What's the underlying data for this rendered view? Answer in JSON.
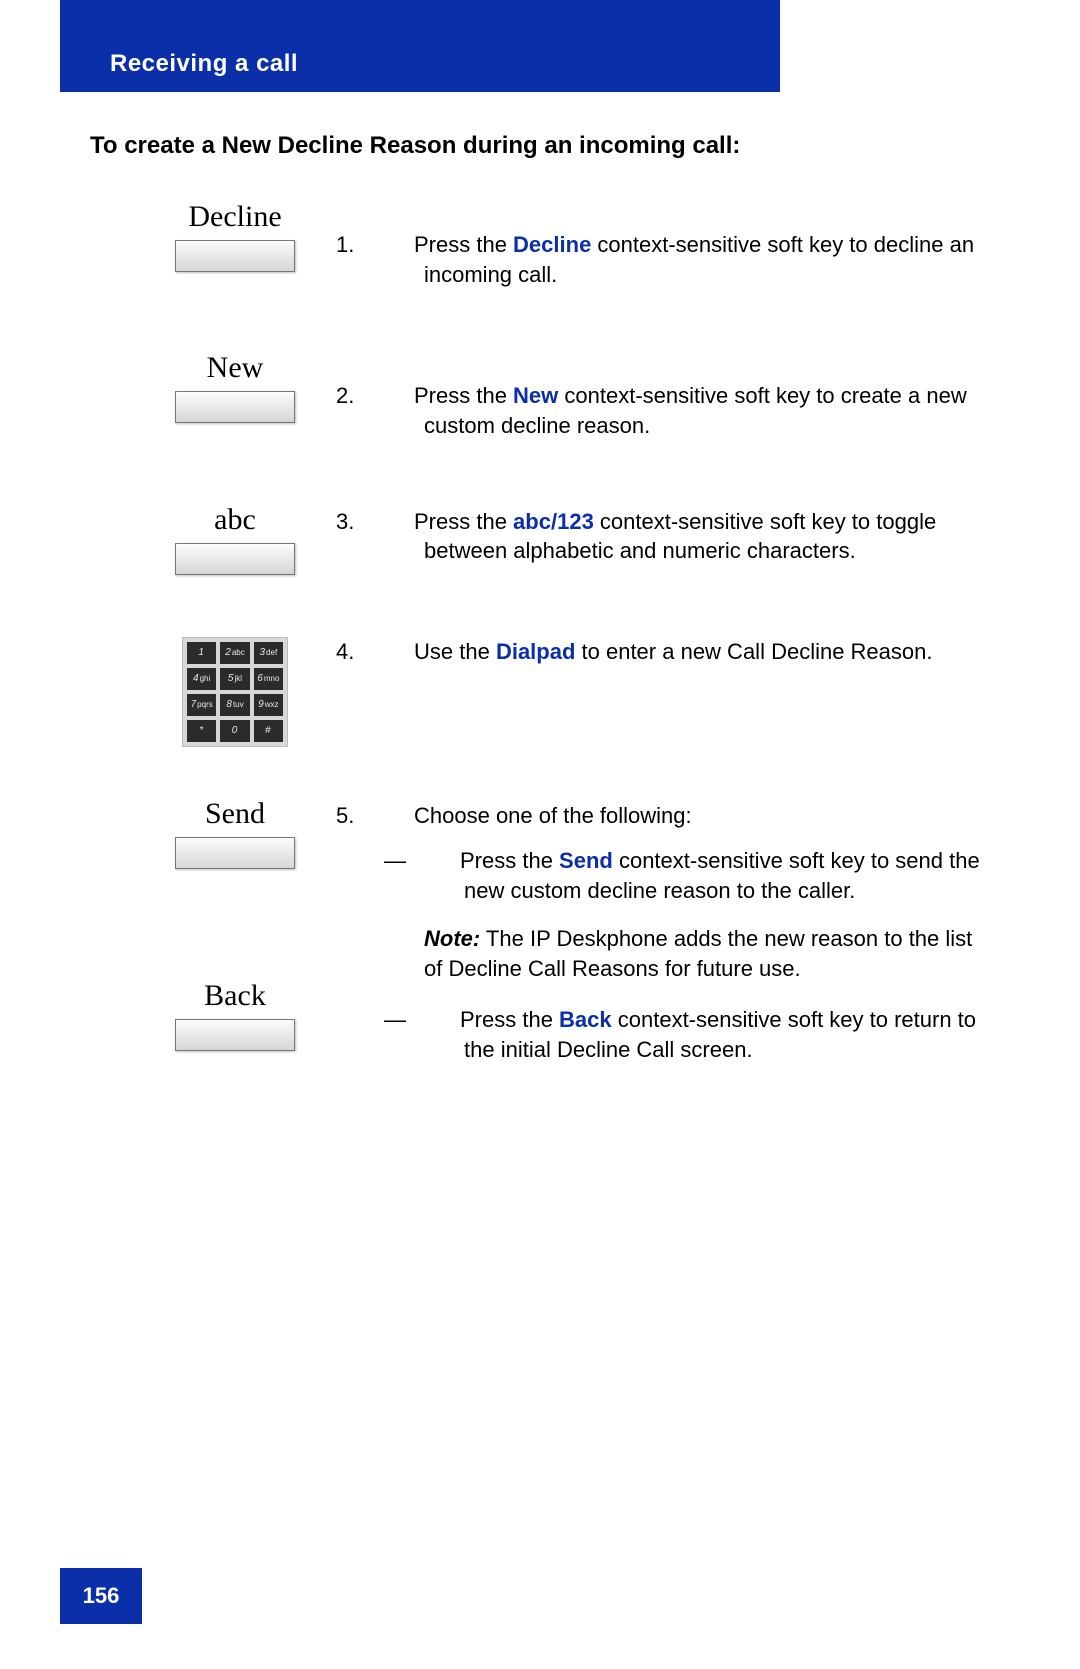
{
  "header": {
    "title": "Receiving a call"
  },
  "heading": "To create a New Decline Reason during an incoming call:",
  "steps": {
    "s1": {
      "softkey": "Decline",
      "num": "1.",
      "pre": "Press the ",
      "kw": "Decline",
      "post": " context-sensitive soft key to decline an incoming call."
    },
    "s2": {
      "softkey": "New",
      "num": "2.",
      "pre": "Press the ",
      "kw": "New",
      "post": " context-sensitive soft key to create a new custom decline reason."
    },
    "s3": {
      "softkey": "abc",
      "num": "3.",
      "pre": "Press the ",
      "kw": "abc",
      "mid": "/",
      "kw2": "123",
      "post": " context-sensitive soft key to toggle between alphabetic and numeric characters."
    },
    "s4": {
      "num": "4.",
      "pre": "Use the ",
      "kw": "Dialpad",
      "post": " to enter a new Call Decline Reason."
    },
    "s5": {
      "softkey_a": "Send",
      "softkey_b": "Back",
      "num": "5.",
      "intro": "Choose one of the following:",
      "opt_a_pre": "Press the ",
      "opt_a_kw": "Send",
      "opt_a_post": " context-sensitive soft key to send the new custom decline reason to the caller.",
      "note_label": "Note:",
      "note_text": "  The IP Deskphone adds the new reason to the list of Decline Call Reasons for future use.",
      "opt_b_pre": "Press the ",
      "opt_b_kw": "Back",
      "opt_b_post": " context-sensitive soft key to return to the initial Decline Call screen."
    }
  },
  "dialpad_keys": [
    "1",
    "2abc",
    "3def",
    "4ghi",
    "5jkl",
    "6mno",
    "7pqrs",
    "8tuv",
    "9wxz",
    "*",
    "0",
    "#"
  ],
  "footer": {
    "page_number": "156"
  },
  "dash": "—"
}
